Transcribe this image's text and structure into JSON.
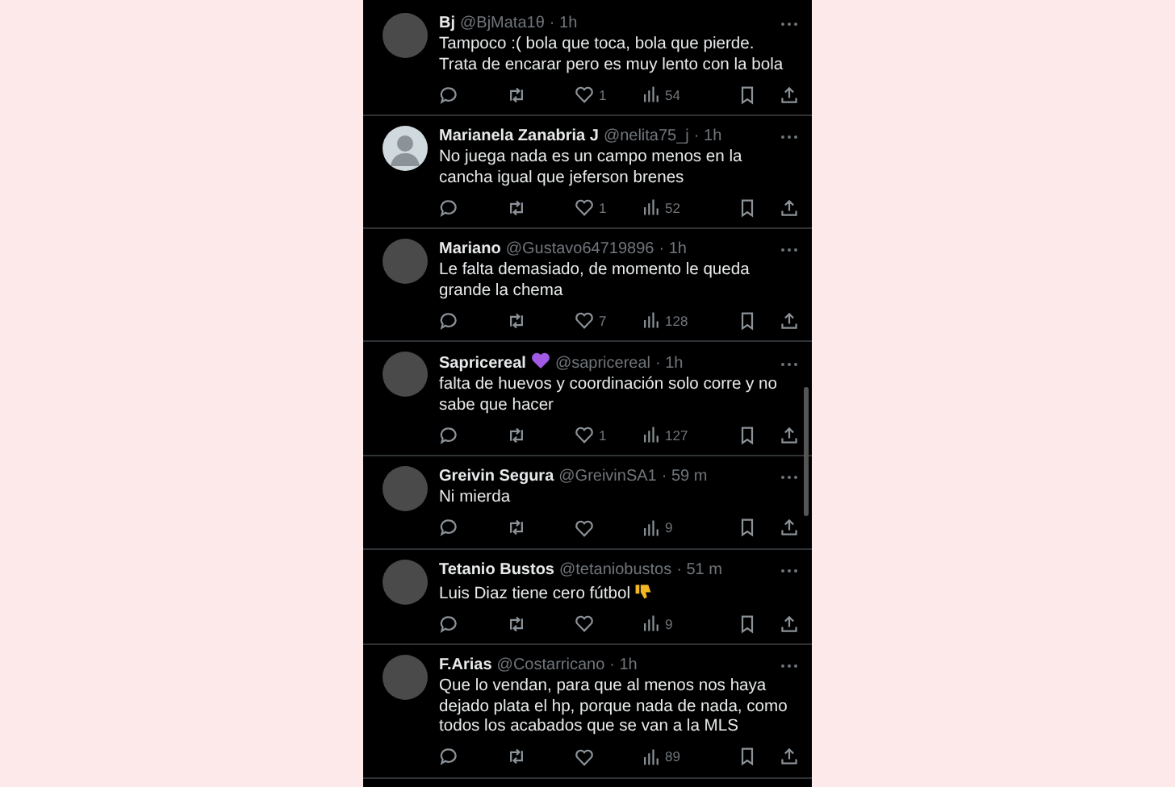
{
  "replies": [
    {
      "default_avatar": false,
      "name": "Bj",
      "name_badge": false,
      "handle": "@BjMata1θ",
      "time": "· 1h",
      "text": "Tampoco :( bola que toca, bola que pierde. Trata de encarar pero es muy lento con la bola",
      "thumbs_down_emoji": false,
      "likes": "1",
      "views": "54"
    },
    {
      "default_avatar": true,
      "name": "Marianela Zanabria J",
      "name_badge": false,
      "handle": "@nelita75_j",
      "time": "· 1h",
      "text": "No juega nada es un campo menos en la cancha igual que jeferson brenes",
      "thumbs_down_emoji": false,
      "likes": "1",
      "views": "52"
    },
    {
      "default_avatar": false,
      "name": "Mariano",
      "name_badge": false,
      "handle": "@Gustavo64719896",
      "time": "· 1h",
      "text": "Le falta demasiado, de momento le queda grande la chema",
      "thumbs_down_emoji": false,
      "likes": "7",
      "views": "128"
    },
    {
      "default_avatar": false,
      "name": "Sapricereal",
      "name_badge": true,
      "handle": "@sapricereal",
      "time": "· 1h",
      "text": "falta de huevos y coordinación solo corre y no sabe que hacer",
      "thumbs_down_emoji": false,
      "likes": "1",
      "views": "127"
    },
    {
      "default_avatar": false,
      "name": "Greivin Segura",
      "name_badge": false,
      "handle": "@GreivinSA1",
      "time": "· 59 m",
      "text": "Ni mierda",
      "thumbs_down_emoji": false,
      "views": "9"
    },
    {
      "default_avatar": false,
      "name": "Tetanio Bustos",
      "name_badge": false,
      "handle": "@tetaniobustos",
      "time": "· 51 m",
      "text": "Luis Diaz tiene cero fútbol",
      "thumbs_down_emoji": true,
      "views": "9"
    },
    {
      "default_avatar": false,
      "name": "F.Arias",
      "name_badge": false,
      "handle": "@Costarricano",
      "time": "· 1h",
      "text": "Que lo vendan, para que al menos nos haya dejado plata el hp, porque nada de nada, como todos los acabados que se van a la MLS",
      "thumbs_down_emoji": false,
      "views": "89"
    }
  ]
}
